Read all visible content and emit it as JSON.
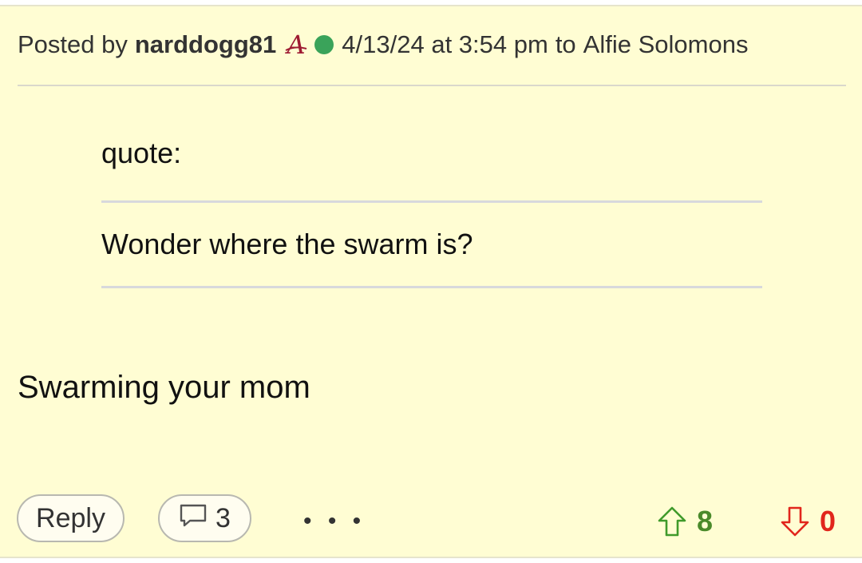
{
  "post": {
    "posted_by_label": "Posted by",
    "username": "narddogg81",
    "team_icon": "alabama-script-a-icon",
    "online_status": "online",
    "timestamp": "4/13/24 at 3:54 pm",
    "to_label": "to",
    "reply_to_user": "Alfie Solomons",
    "quote_label": "quote:",
    "quote_text": "Wonder where the swarm is?",
    "body": "Swarming your mom"
  },
  "actions": {
    "reply_label": "Reply",
    "comment_count": "3",
    "more_label": "• • •",
    "upvotes": "8",
    "downvotes": "0"
  },
  "colors": {
    "post_background": "#fffdd3",
    "online_dot": "#3aa35a",
    "upvote": "#4a8a2a",
    "downvote": "#e1261c",
    "team_crimson": "#9e1b32"
  }
}
